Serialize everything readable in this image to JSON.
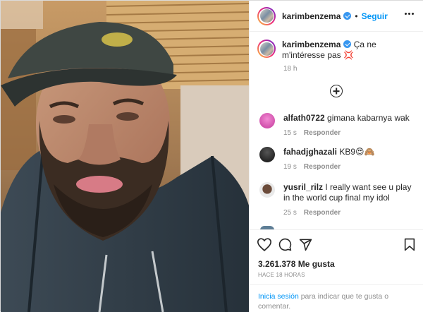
{
  "post": {
    "photo_alt": "",
    "header": {
      "username": "karimbenzema",
      "separator": "•",
      "follow_label": "Seguir"
    },
    "caption": {
      "username": "karimbenzema",
      "text": "Ça ne m'intéresse pas",
      "emoji": "💢",
      "time": "18 h"
    },
    "comments": [
      {
        "username": "alfath0722",
        "text": "gimana kabarnya wak",
        "time": "15 s",
        "reply_label": "Responder",
        "avatar_color": "#e05ac0"
      },
      {
        "username": "fahadjghazali",
        "text": "KB9",
        "emoji": "😍🙈",
        "time": "19 s",
        "reply_label": "Responder",
        "avatar_color": "#1a1a1a"
      },
      {
        "username": "yusril_rilz",
        "text": "I really want see u play in the world cup final my idol",
        "time": "25 s",
        "reply_label": "Responder",
        "avatar_color": "#f1f1f1"
      }
    ],
    "likes": "3.261.378 Me gusta",
    "posted_ago": "HACE 18 HORAS",
    "login_prompt": {
      "link": "Inicia sesión",
      "text": " para indicar que te gusta o comentar."
    }
  },
  "colors": {
    "accent_blue": "#0095f6",
    "verified_blue": "#3897f0",
    "muted_text": "#8e8e8e"
  },
  "icons": [
    "more-icon",
    "verified-icon",
    "add-circle-icon",
    "heart-icon",
    "comment-icon",
    "share-icon",
    "bookmark-icon"
  ]
}
